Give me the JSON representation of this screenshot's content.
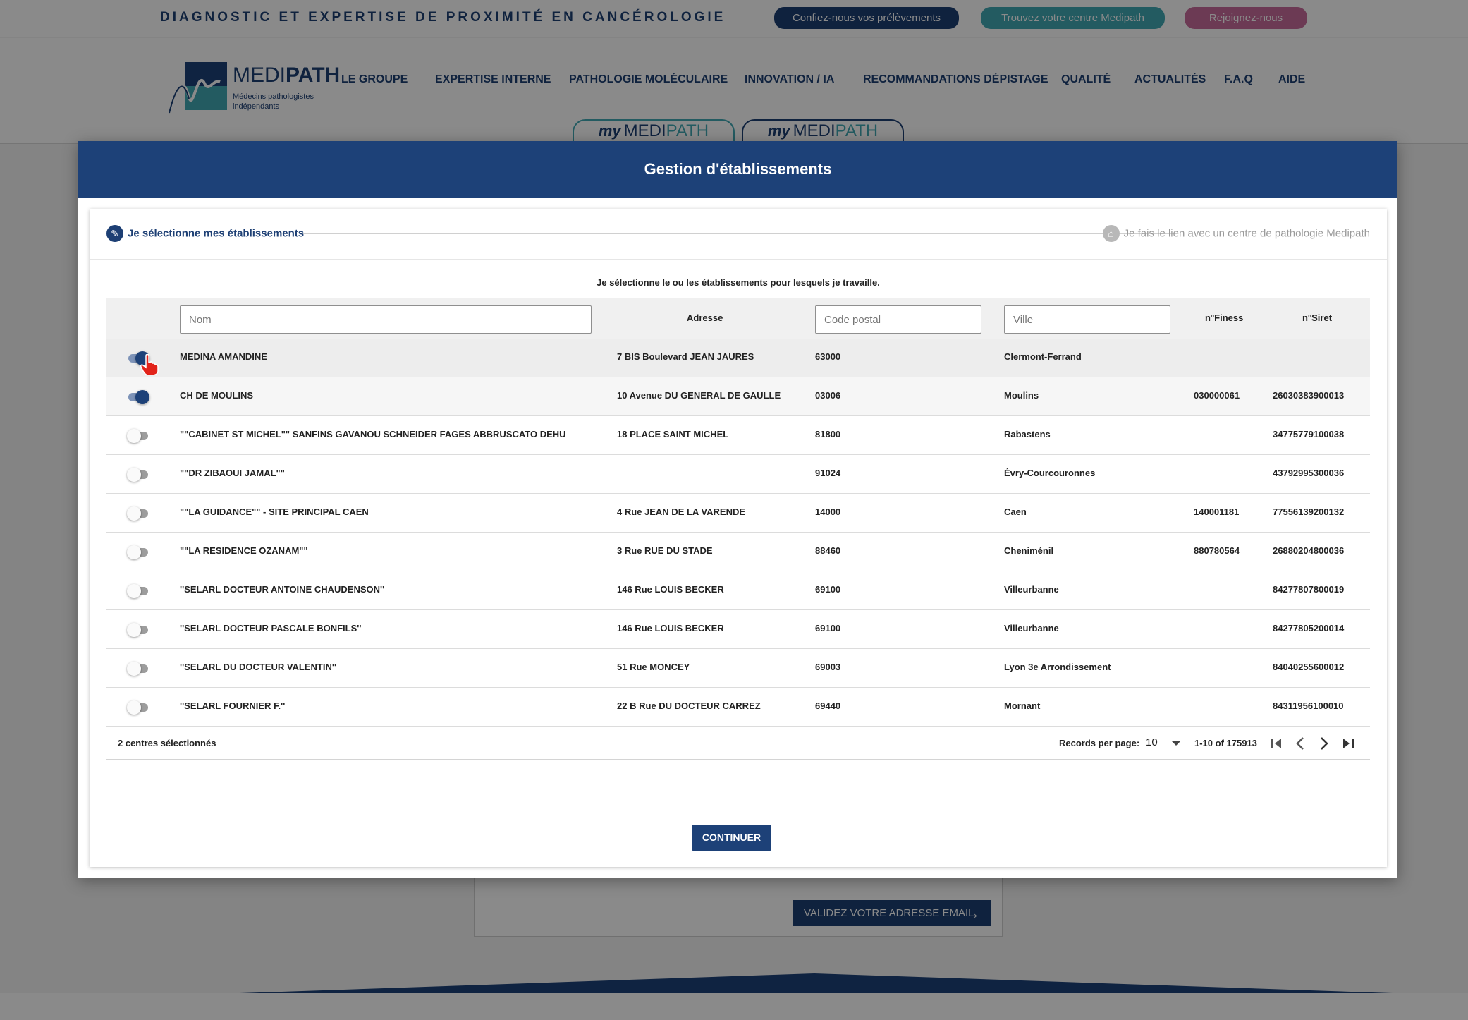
{
  "topbar": {
    "tagline": "DIAGNOSTIC ET EXPERTISE DE PROXIMITÉ EN CANCÉROLOGIE",
    "pills": [
      "Confiez-nous vos prélèvements",
      "Trouvez votre centre Medipath",
      "Rejoignez-nous"
    ]
  },
  "logo": {
    "brand_light": "MEDI",
    "brand_bold": "PATH",
    "sub_line1": "Médecins pathologistes",
    "sub_line2": "indépendants"
  },
  "nav": [
    "LE GROUPE",
    "EXPERTISE INTERNE",
    "PATHOLOGIE MOLÉCULAIRE",
    "INNOVATION / IA",
    "RECOMMANDATIONS DÉPISTAGE",
    "QUALITÉ",
    "ACTUALITÉS",
    "F.A.Q",
    "AIDE"
  ],
  "mytabs": {
    "my": "my",
    "medi": "MEDI",
    "path": "PATH"
  },
  "background": {
    "validate_email": "VALIDEZ VOTRE ADRESSE EMAIL"
  },
  "modal": {
    "title": "Gestion d'établissements",
    "step1": "Je sélectionne mes établissements",
    "step2": "Je fais le lien avec un centre de pathologie Medipath",
    "intro": "Je sélectionne le ou les établissements pour lesquels je travaille.",
    "continue": "CONTINUER"
  },
  "table": {
    "filters": {
      "nom_placeholder": "Nom",
      "cp_placeholder": "Code postal",
      "ville_placeholder": "Ville"
    },
    "headers": {
      "adresse": "Adresse",
      "finess": "n°Finess",
      "siret": "n°Siret"
    },
    "rows": [
      {
        "nom": "MEDINA AMANDINE",
        "adresse": "7 BIS Boulevard JEAN JAURES",
        "cp": "63000",
        "ville": "Clermont-Ferrand",
        "finess": "",
        "siret": "",
        "selected": true
      },
      {
        "nom": "CH DE MOULINS",
        "adresse": "10 Avenue DU GENERAL DE GAULLE",
        "cp": "03006",
        "ville": "Moulins",
        "finess": "030000061",
        "siret": "26030383900013",
        "selected": true
      },
      {
        "nom": "\"\"CABINET ST MICHEL\"\" SANFINS GAVANOU SCHNEIDER FAGES ABBRUSCATO DEHU",
        "adresse": "18 PLACE SAINT MICHEL",
        "cp": "81800",
        "ville": "Rabastens",
        "finess": "",
        "siret": "34775779100038",
        "selected": false
      },
      {
        "nom": "\"\"DR ZIBAOUI JAMAL\"\"",
        "adresse": "",
        "cp": "91024",
        "ville": "Évry-Courcouronnes",
        "finess": "",
        "siret": "43792995300036",
        "selected": false
      },
      {
        "nom": "\"\"LA GUIDANCE\"\" - SITE PRINCIPAL CAEN",
        "adresse": "4 Rue JEAN DE LA VARENDE",
        "cp": "14000",
        "ville": "Caen",
        "finess": "140001181",
        "siret": "77556139200132",
        "selected": false
      },
      {
        "nom": "\"\"LA RESIDENCE OZANAM\"\"",
        "adresse": "3 Rue RUE DU STADE",
        "cp": "88460",
        "ville": "Cheniménil",
        "finess": "880780564",
        "siret": "26880204800036",
        "selected": false
      },
      {
        "nom": "''SELARL DOCTEUR ANTOINE CHAUDENSON''",
        "adresse": "146 Rue LOUIS BECKER",
        "cp": "69100",
        "ville": "Villeurbanne",
        "finess": "",
        "siret": "84277807800019",
        "selected": false
      },
      {
        "nom": "''SELARL DOCTEUR PASCALE BONFILS''",
        "adresse": "146 Rue LOUIS BECKER",
        "cp": "69100",
        "ville": "Villeurbanne",
        "finess": "",
        "siret": "84277805200014",
        "selected": false
      },
      {
        "nom": "''SELARL DU DOCTEUR VALENTIN''",
        "adresse": "51 Rue MONCEY",
        "cp": "69003",
        "ville": "Lyon 3e Arrondissement",
        "finess": "",
        "siret": "84040255600012",
        "selected": false
      },
      {
        "nom": "''SELARL FOURNIER F.''",
        "adresse": "22 B Rue DU DOCTEUR CARREZ",
        "cp": "69440",
        "ville": "Mornant",
        "finess": "",
        "siret": "84311956100010",
        "selected": false
      }
    ],
    "footer": {
      "selected_count": "2 centres sélectionnés",
      "records_per_page_label": "Records per page:",
      "records_per_page": "10",
      "range": "1-10 of 175913"
    }
  },
  "colors": {
    "primary": "#1d4178",
    "teal": "#41a9b3",
    "pink": "#c86b9b"
  }
}
